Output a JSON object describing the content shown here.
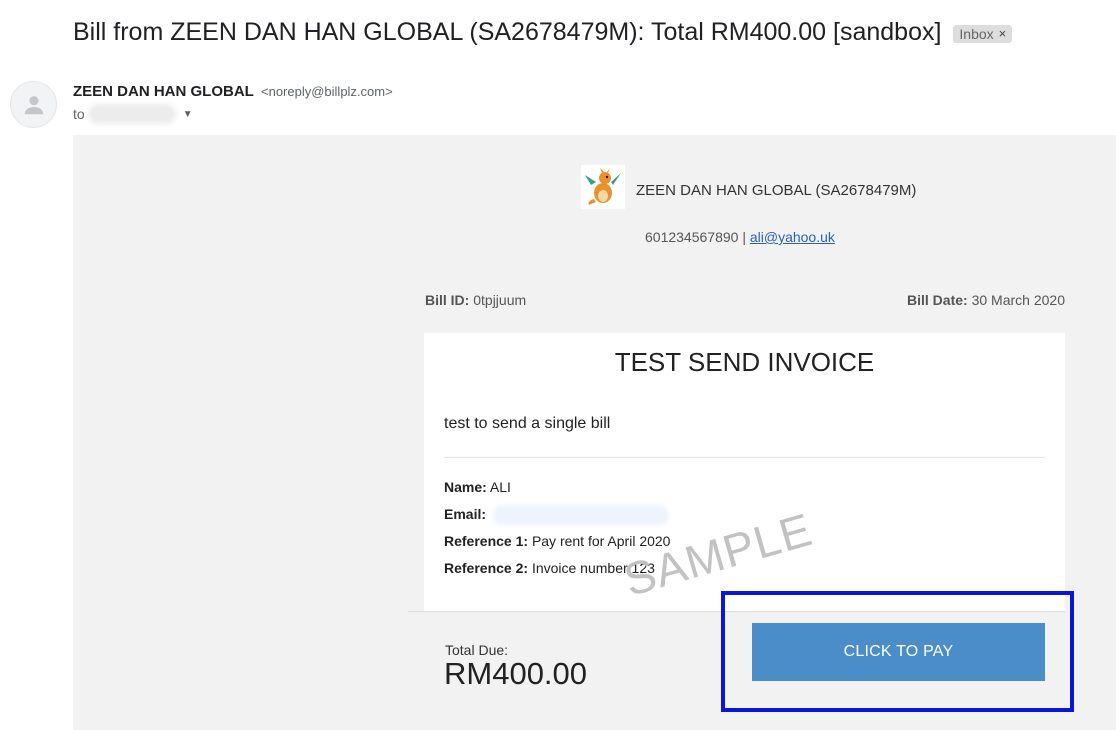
{
  "email": {
    "subject": "Bill from ZEEN DAN HAN GLOBAL (SA2678479M): Total RM400.00 [sandbox]",
    "label": "Inbox",
    "label_remove": "×",
    "sender_name": "ZEEN DAN HAN GLOBAL",
    "sender_email": "<noreply@billplz.com>",
    "to_label": "to"
  },
  "bill": {
    "merchant_name": "ZEEN DAN HAN GLOBAL (SA2678479M)",
    "phone": "601234567890",
    "separator": " | ",
    "contact_email": "ali@yahoo.uk",
    "bill_id_label": "Bill ID:",
    "bill_id": "0tpjjuum",
    "bill_date_label": "Bill Date:",
    "bill_date": "30 March 2020",
    "title": "TEST SEND INVOICE",
    "description": "test to send a single bill",
    "name_label": "Name:",
    "name": "ALI",
    "email_label": "Email:",
    "ref1_label": "Reference 1:",
    "ref1": "Pay rent for April 2020",
    "ref2_label": "Reference 2:",
    "ref2": "Invoice number 123",
    "total_label": "Total Due:",
    "total": "RM400.00",
    "pay_button": "CLICK TO PAY",
    "watermark": "SAMPLE"
  },
  "colors": {
    "pay_button": "#4b8dc8",
    "highlight_box": "#0b17d6",
    "link": "#2a62b8"
  },
  "icons": {
    "avatar": "person-icon",
    "logo": "dragon-logo",
    "caret": "chevron-down-icon"
  }
}
